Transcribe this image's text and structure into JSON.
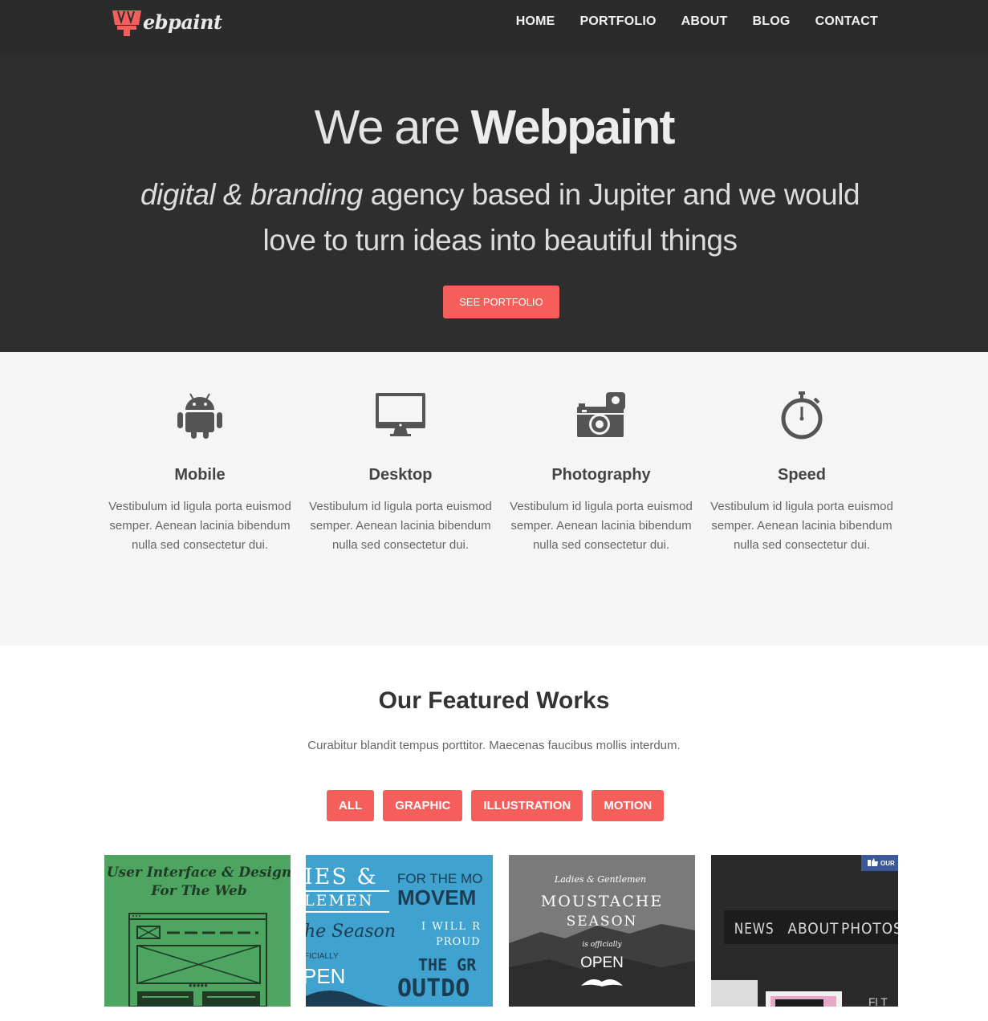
{
  "header": {
    "logo_text": "ebpaint",
    "nav": [
      "HOME",
      "PORTFOLIO",
      "ABOUT",
      "BLOG",
      "CONTACT"
    ]
  },
  "hero": {
    "title_light": "We are",
    "title_bold": "Webpaint",
    "subtitle_italic": "digital & branding",
    "subtitle_rest": " agency based in Jupiter and we would love to turn ideas into beautiful things",
    "button": "SEE PORTFOLIO"
  },
  "services": [
    {
      "icon": "android-icon",
      "title": "Mobile",
      "text": "Vestibulum id ligula porta euismod semper. Aenean lacinia bibendum nulla sed consectetur dui."
    },
    {
      "icon": "monitor-icon",
      "title": "Desktop",
      "text": "Vestibulum id ligula porta euismod semper. Aenean lacinia bibendum nulla sed consectetur dui."
    },
    {
      "icon": "camera-icon",
      "title": "Photography",
      "text": "Vestibulum id ligula porta euismod semper. Aenean lacinia bibendum nulla sed consectetur dui."
    },
    {
      "icon": "stopwatch-icon",
      "title": "Speed",
      "text": "Vestibulum id ligula porta euismod semper. Aenean lacinia bibendum nulla sed consectetur dui."
    }
  ],
  "works": {
    "title": "Our Featured Works",
    "subtitle": "Curabitur blandit tempus porttitor. Maecenas faucibus mollis interdum.",
    "filters": [
      "ALL",
      "GRAPHIC",
      "ILLUSTRATION",
      "MOTION"
    ],
    "thumbs": [
      {
        "line1": "User Interface & Design",
        "line2": "For The Web"
      },
      {
        "a": "IES &",
        "b": "FOR THE MO",
        "c": "LEMEN",
        "d": "MOVEM",
        "e": "he Season",
        "f": "I WILL R",
        "g": "PROUD",
        "h": "FICIALLY",
        "i": "THE GR",
        "j": "PEN",
        "k": "OUTDO"
      },
      {
        "a": "Ladies & Gentlemen",
        "b": "MOUSTACHE",
        "c": "SEASON",
        "d": "is officially",
        "e": "OPEN"
      },
      {
        "badge": "OUR",
        "nav": [
          "NEWS",
          "ABOUT",
          "PHOTOS"
        ],
        "frag": "Fl T"
      }
    ]
  },
  "colors": {
    "accent": "#f55e5b",
    "dark": "#2e2e2e",
    "light_bg": "#f5f5f5"
  }
}
